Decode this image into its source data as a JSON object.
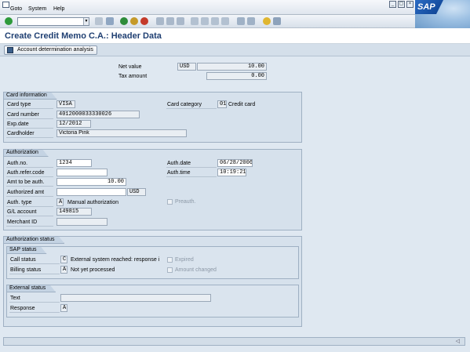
{
  "menu": {
    "items": [
      "Goto",
      "System",
      "Help"
    ]
  },
  "window_buttons": [
    "_",
    "▢",
    "×"
  ],
  "title": "Create Credit Memo C.A.: Header Data",
  "app_toolbar": {
    "account_btn": "Account determination analysis"
  },
  "totals": {
    "net_value_label": "Net value",
    "currency": "USD",
    "net_value": "10.00",
    "tax_amount_label": "Tax amount",
    "tax_amount": "0.00"
  },
  "card_info": {
    "title": "Card information",
    "card_type_label": "Card type",
    "card_type": "VISA",
    "card_number_label": "Card number",
    "card_number": "4012000033330026",
    "exp_date_label": "Exp.date",
    "exp_date": "12/2012",
    "cardholder_label": "Cardholder",
    "cardholder": "Victoria Pink",
    "card_category_label": "Card category",
    "card_category_code": "01",
    "card_category_text": "Credit card"
  },
  "authorization": {
    "title": "Authorization",
    "auth_no_label": "Auth.no.",
    "auth_no": "1234",
    "auth_refer_label": "Auth.refer.code",
    "auth_refer": "",
    "amt_to_auth_label": "Amt to be auth.",
    "amt_to_auth": "10.00",
    "authorized_amt_label": "Authorized amt",
    "authorized_amt": "",
    "authorized_currency": "USD",
    "auth_type_label": "Auth. type",
    "auth_type_code": "A",
    "auth_type_text": "Manual authorization",
    "gl_account_label": "G/L account",
    "gl_account": "149815",
    "merchant_id_label": "Merchant ID",
    "merchant_id": "",
    "auth_date_label": "Auth.date",
    "auth_date": "06/28/2006",
    "auth_time_label": "Auth.time",
    "auth_time": "10:19:21",
    "preauth_label": "Preauth."
  },
  "auth_status": {
    "title": "Authorization status",
    "sap_status": {
      "title": "SAP status",
      "call_status_label": "Call status",
      "call_status_code": "C",
      "call_status_text": "External system reached: response i",
      "billing_status_label": "Billing status",
      "billing_status_code": "A",
      "billing_status_text": "Not yet processed",
      "expired_label": "Expired",
      "amount_changed_label": "Amount changed"
    },
    "external_status": {
      "title": "External status",
      "text_label": "Text",
      "text_value": "",
      "response_label": "Response",
      "response_value": "A"
    }
  }
}
